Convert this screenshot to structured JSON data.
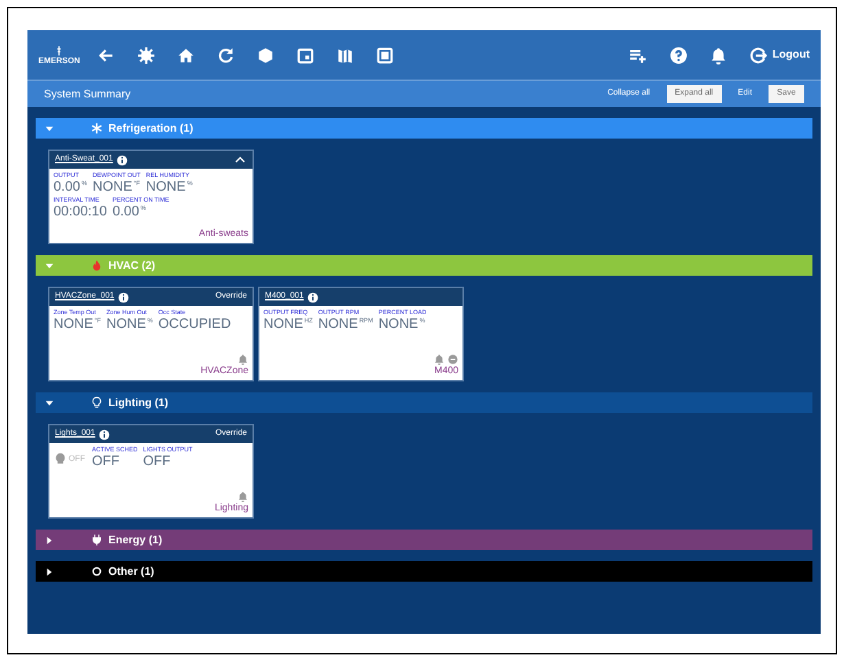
{
  "header": {
    "logo": "EMERSON",
    "logout": "Logout"
  },
  "subbar": {
    "title": "System Summary",
    "buttons": [
      {
        "label": "Collapse all",
        "disabled": false
      },
      {
        "label": "Expand all",
        "disabled": true
      },
      {
        "label": "Edit",
        "disabled": false
      },
      {
        "label": "Save",
        "disabled": true
      }
    ]
  },
  "sections": [
    {
      "title": "Refrigeration (1)",
      "expanded": true,
      "color": "#2f8cf0",
      "kind": "refrigeration",
      "cards": [
        {
          "title": "Anti-Sweat_001",
          "kind": "anti-sweat",
          "fields": [
            {
              "label": "OUTPUT",
              "value": "0.00",
              "unit": "%"
            },
            {
              "label": "DEWPOINT OUT",
              "value": "NONE",
              "unit": "°F"
            },
            {
              "label": "REL HUMIDITY",
              "value": "NONE",
              "unit": "%"
            },
            {
              "label": "INTERVAL TIME",
              "value": "00:00:10"
            },
            {
              "label": "PERCENT ON TIME",
              "value": "0.00",
              "unit": "%"
            }
          ],
          "footer": "Anti-sweats"
        }
      ]
    },
    {
      "title": "HVAC (2)",
      "expanded": true,
      "color": "#8dc63f",
      "kind": "hvac",
      "cards": [
        {
          "title": "HVACZone_001",
          "kind": "zone",
          "override": "Override",
          "fields": [
            {
              "label": "Zone Temp Out",
              "value": "NONE",
              "unit": "°F"
            },
            {
              "label": "Zone Hum Out",
              "value": "NONE",
              "unit": "%"
            },
            {
              "label": "Occ State",
              "value": "OCCUPIED"
            }
          ],
          "footer": "HVACZone"
        },
        {
          "title": "M400_001",
          "kind": "drive",
          "fields": [
            {
              "label": "OUTPUT FREQ",
              "value": "NONE",
              "unit": "HZ"
            },
            {
              "label": "OUTPUT RPM",
              "value": "NONE",
              "unit": "RPM"
            },
            {
              "label": "PERCENT LOAD",
              "value": "NONE",
              "unit": "%"
            }
          ],
          "footer": "M400"
        }
      ]
    },
    {
      "title": "Lighting (1)",
      "expanded": true,
      "color": "#0e4f94",
      "kind": "lighting",
      "cards": [
        {
          "title": "Lights_001",
          "kind": "lighting",
          "override": "Override",
          "lamp": "OFF",
          "fields": [
            {
              "label": "ACTIVE SCHED",
              "value": "OFF"
            },
            {
              "label": "LIGHTS OUTPUT",
              "value": "OFF"
            }
          ],
          "footer": "Lighting"
        }
      ]
    },
    {
      "title": "Energy (1)",
      "expanded": false,
      "color": "#743c78",
      "kind": "energy"
    },
    {
      "title": "Other (1)",
      "expanded": false,
      "color": "#000000",
      "kind": "other"
    }
  ]
}
